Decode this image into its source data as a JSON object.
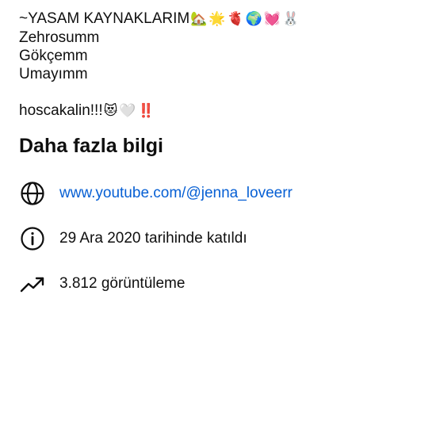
{
  "description": {
    "lines": [
      {
        "text": "~YASAM KAYNAKLARIM",
        "emojis": "🏡🌟🫀🌍💓🐰"
      },
      {
        "text": "Zehrosumm",
        "emojis": ""
      },
      {
        "text": "Gökçemm",
        "emojis": ""
      },
      {
        "text": "Umayımm",
        "emojis": ""
      },
      {
        "text": "",
        "emojis": ""
      },
      {
        "text": "hoscakalin!!!",
        "emojis": "😻🤍‼️"
      }
    ]
  },
  "more_info": {
    "title": "Daha fazla bilgi",
    "items": [
      {
        "icon": "globe-icon",
        "text": "www.youtube.com/@jenna_loveerr",
        "is_link": true
      },
      {
        "icon": "info-icon",
        "text": "29 Ara 2020 tarihinde katıldı",
        "is_link": false
      },
      {
        "icon": "trending-up-icon",
        "text": "3.812 görüntüleme",
        "is_link": false
      }
    ]
  },
  "colors": {
    "link": "#065fd4",
    "text": "#0f0f0f",
    "background": "#ffffff"
  }
}
